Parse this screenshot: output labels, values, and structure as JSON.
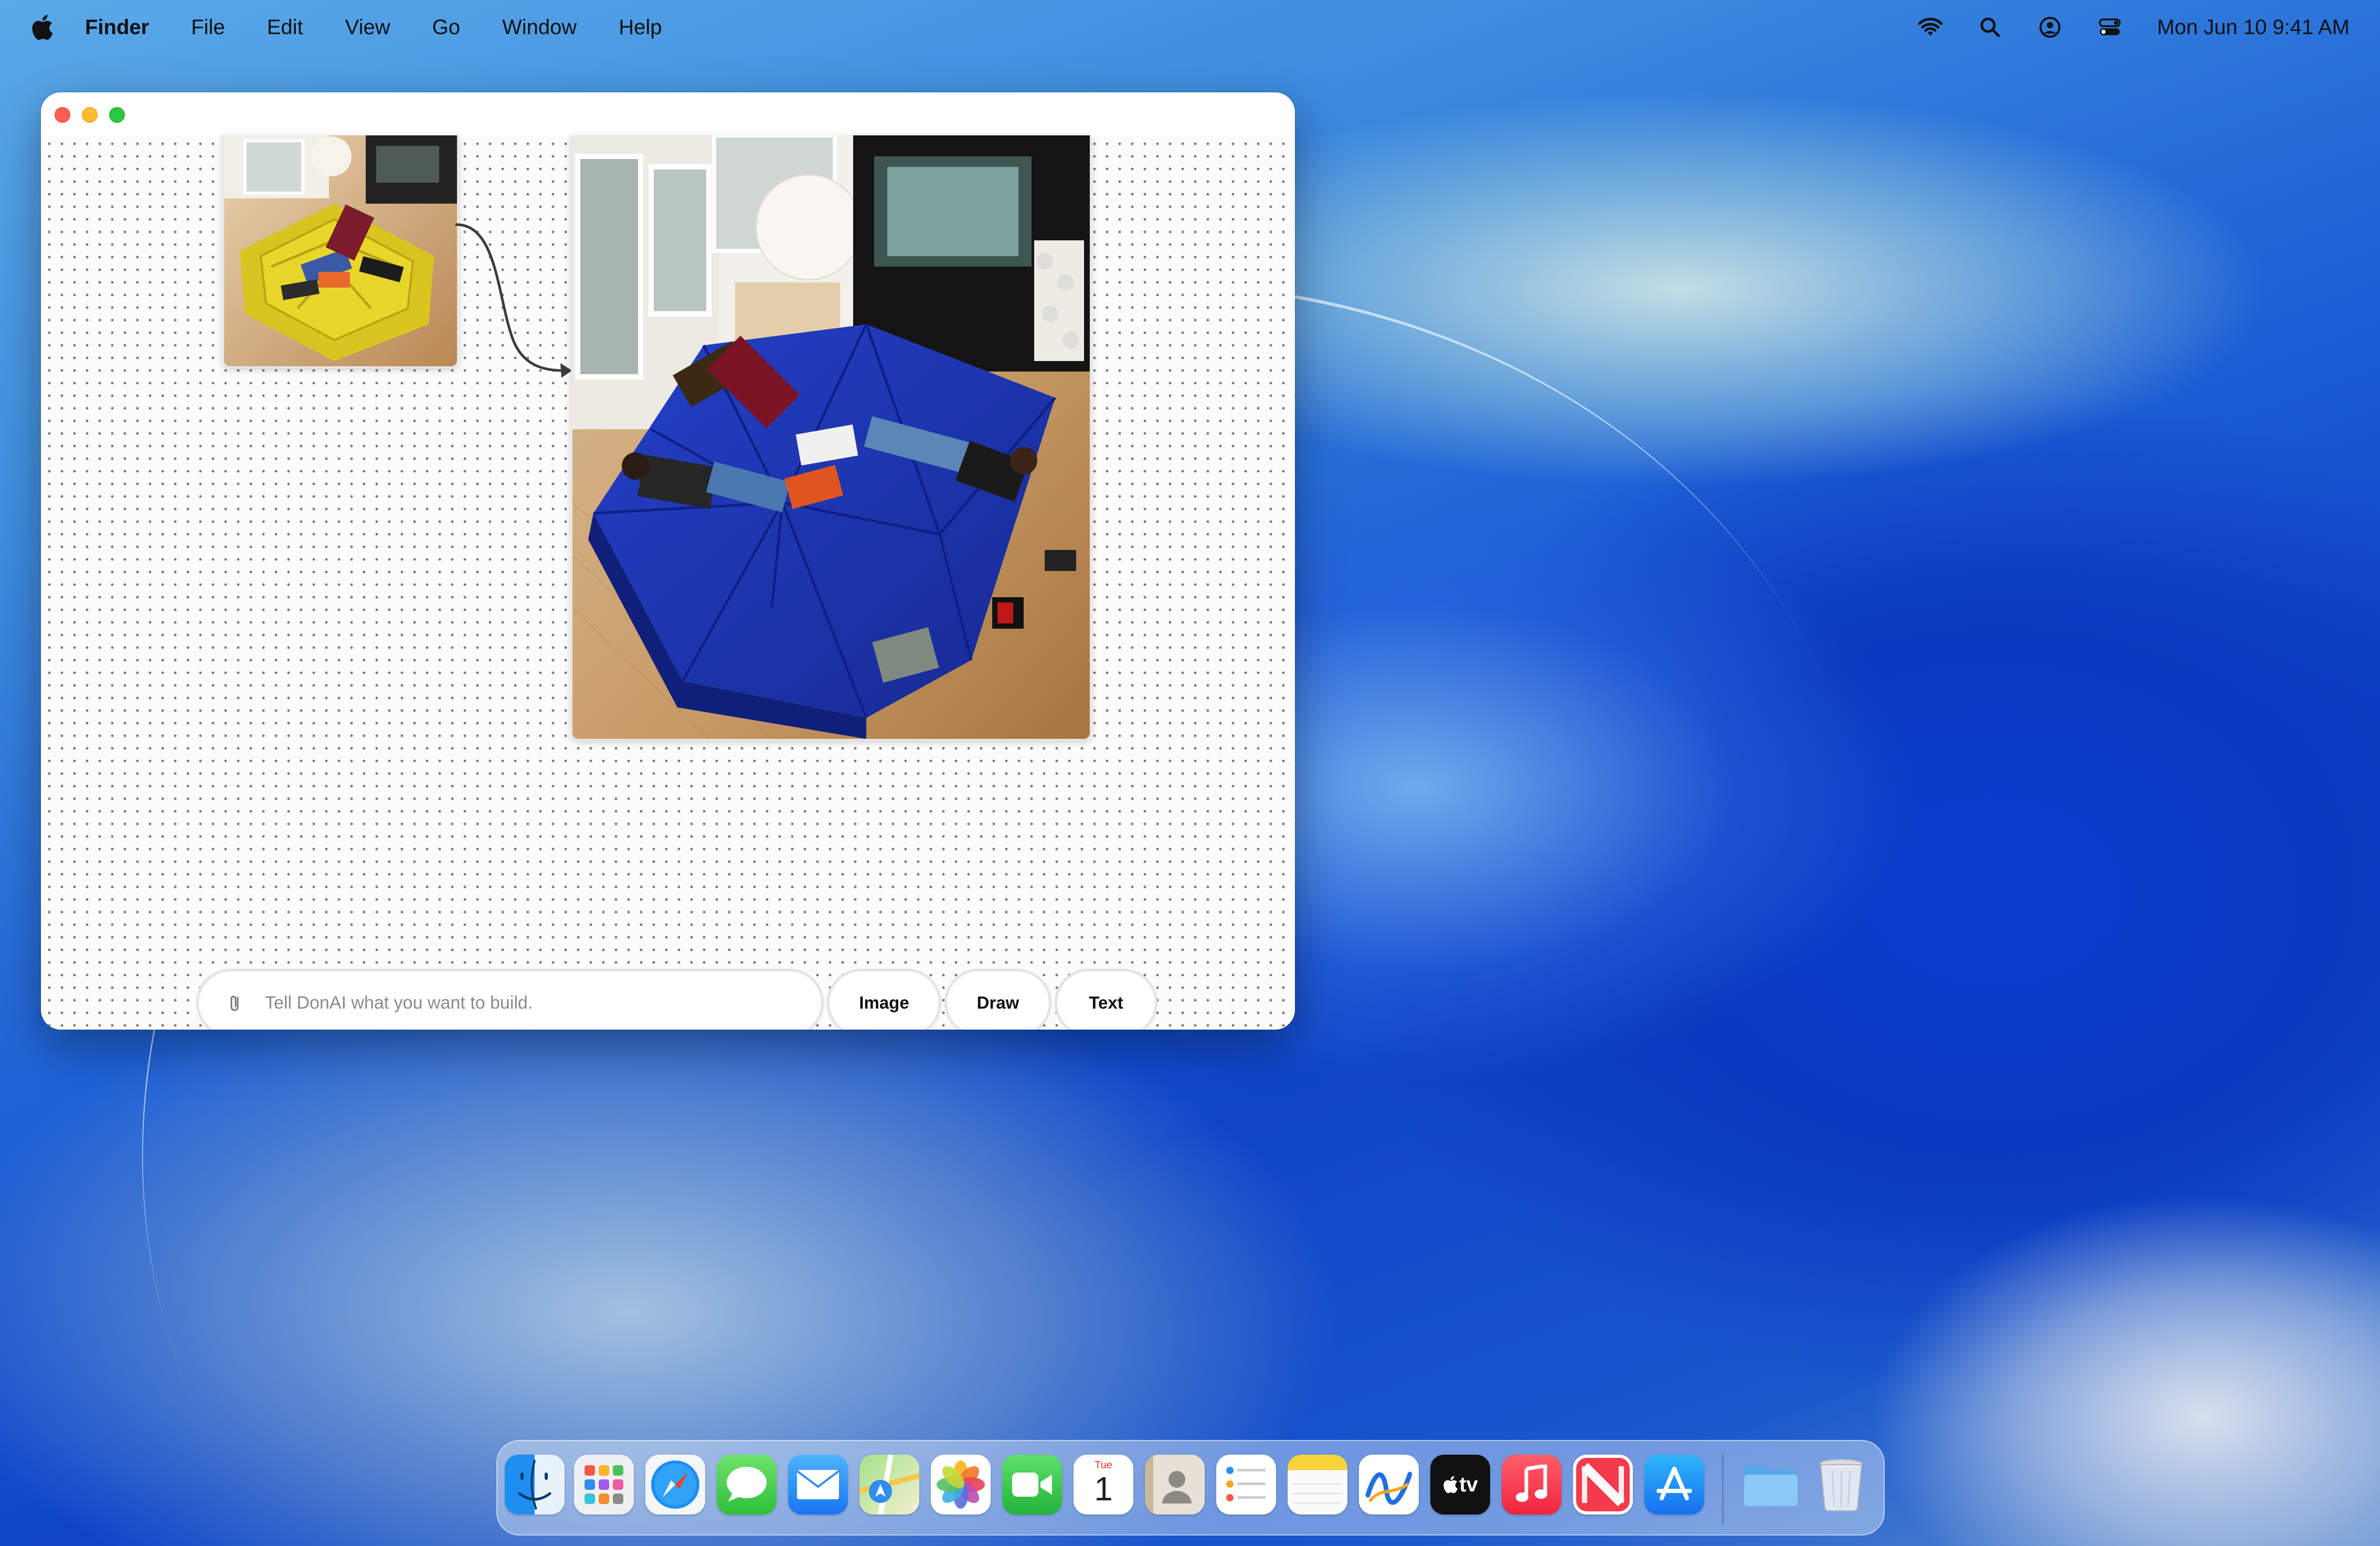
{
  "menubar": {
    "app_name": "Finder",
    "menus": [
      "File",
      "Edit",
      "View",
      "Go",
      "Window",
      "Help"
    ],
    "clock": "Mon Jun 10  9:41 AM"
  },
  "canvas": {
    "prompt_placeholder": "Tell DonAI what you want to build.",
    "buttons": {
      "image": "Image",
      "draw": "Draw",
      "text": "Text"
    }
  },
  "calendar": {
    "day": "Tue",
    "date": "1"
  },
  "tv_label": "tv",
  "dock": {
    "apps": [
      "finder",
      "launchpad",
      "safari",
      "messages",
      "mail",
      "maps",
      "photos",
      "facetime",
      "calendar",
      "contacts",
      "reminders",
      "notes",
      "freeform",
      "tv",
      "music",
      "news",
      "app-store",
      "downloads-folder",
      "trash"
    ]
  }
}
